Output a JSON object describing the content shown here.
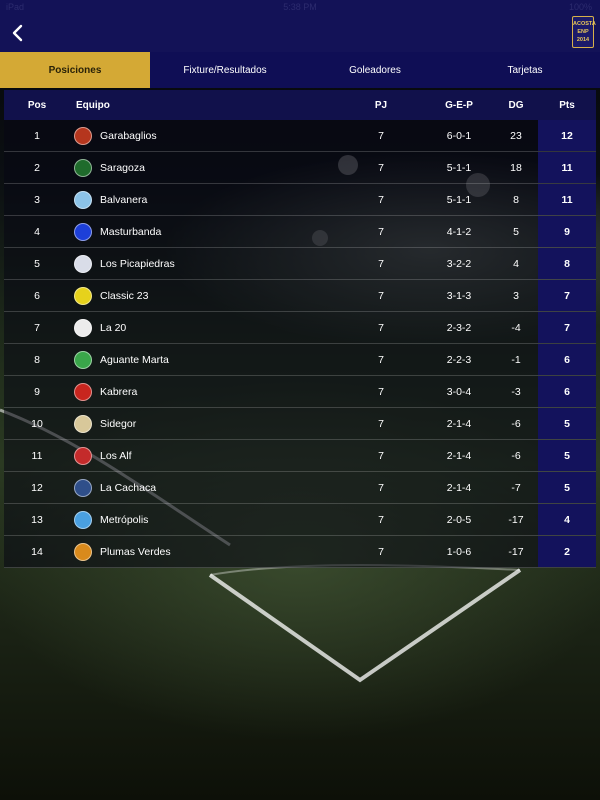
{
  "status_bar": {
    "carrier": "iPad",
    "time": "5:38 PM",
    "battery": "100%"
  },
  "nav": {
    "back_icon": "chevron-left-icon",
    "logo_text": [
      "ACOSTA",
      "ENP",
      "2014"
    ]
  },
  "tabs": [
    {
      "label": "Posiciones",
      "active": true
    },
    {
      "label": "Fixture/Resultados",
      "active": false
    },
    {
      "label": "Goleadores",
      "active": false
    },
    {
      "label": "Tarjetas",
      "active": false
    }
  ],
  "table": {
    "headers": {
      "pos": "Pos",
      "team": "Equipo",
      "pj": "PJ",
      "gep": "G-E-P",
      "dg": "DG",
      "pts": "Pts"
    },
    "rows": [
      {
        "pos": "1",
        "team": "Garabaglios",
        "pj": "7",
        "gep": "6-0-1",
        "dg": "23",
        "pts": "12",
        "crest": "#b5361e"
      },
      {
        "pos": "2",
        "team": "Saragoza",
        "pj": "7",
        "gep": "5-1-1",
        "dg": "18",
        "pts": "11",
        "crest": "#1f6b2c"
      },
      {
        "pos": "3",
        "team": "Balvanera",
        "pj": "7",
        "gep": "5-1-1",
        "dg": "8",
        "pts": "11",
        "crest": "#8cc3e8"
      },
      {
        "pos": "4",
        "team": "Masturbanda",
        "pj": "7",
        "gep": "4-1-2",
        "dg": "5",
        "pts": "9",
        "crest": "#1d3fd8"
      },
      {
        "pos": "5",
        "team": "Los Picapiedras",
        "pj": "7",
        "gep": "3-2-2",
        "dg": "4",
        "pts": "8",
        "crest": "#d9dde8"
      },
      {
        "pos": "6",
        "team": "Classic 23",
        "pj": "7",
        "gep": "3-1-3",
        "dg": "3",
        "pts": "7",
        "crest": "#e6d21c"
      },
      {
        "pos": "7",
        "team": "La 20",
        "pj": "7",
        "gep": "2-3-2",
        "dg": "-4",
        "pts": "7",
        "crest": "#ececec"
      },
      {
        "pos": "8",
        "team": "Aguante Marta",
        "pj": "7",
        "gep": "2-2-3",
        "dg": "-1",
        "pts": "6",
        "crest": "#3aa64a"
      },
      {
        "pos": "9",
        "team": "Kabrera",
        "pj": "7",
        "gep": "3-0-4",
        "dg": "-3",
        "pts": "6",
        "crest": "#c8251e"
      },
      {
        "pos": "10",
        "team": "Sidegor",
        "pj": "7",
        "gep": "2-1-4",
        "dg": "-6",
        "pts": "5",
        "crest": "#d8c89a"
      },
      {
        "pos": "11",
        "team": "Los Alf",
        "pj": "7",
        "gep": "2-1-4",
        "dg": "-6",
        "pts": "5",
        "crest": "#c42b2b"
      },
      {
        "pos": "12",
        "team": "La Cachaca",
        "pj": "7",
        "gep": "2-1-4",
        "dg": "-7",
        "pts": "5",
        "crest": "#2f4f8a"
      },
      {
        "pos": "13",
        "team": "Metrópolis",
        "pj": "7",
        "gep": "2-0-5",
        "dg": "-17",
        "pts": "4",
        "crest": "#4aa0e0"
      },
      {
        "pos": "14",
        "team": "Plumas Verdes",
        "pj": "7",
        "gep": "1-0-6",
        "dg": "-17",
        "pts": "2",
        "crest": "#d98a1c"
      }
    ]
  }
}
